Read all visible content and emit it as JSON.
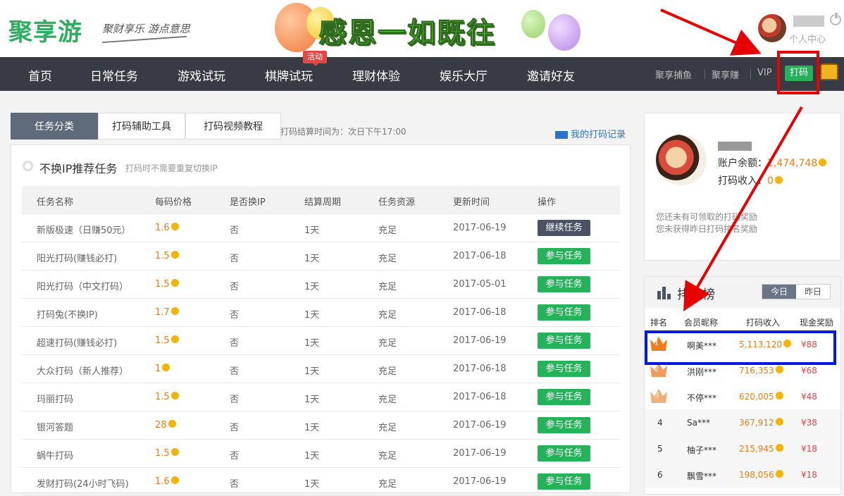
{
  "header": {
    "logo": "聚享游",
    "slogan": "聚财享乐 游点意思",
    "banner_text": "感恩一如既往",
    "personal_center": "个人中心"
  },
  "nav": {
    "items": [
      "首页",
      "日常任务",
      "游戏试玩",
      "棋牌试玩",
      "理财体验",
      "娱乐大厅",
      "邀请好友"
    ],
    "hot_badge": "活动",
    "right_items": [
      "聚享捕鱼",
      "聚享赚",
      "VIP"
    ],
    "dama_button": "打码"
  },
  "tabs": [
    "任务分类",
    "打码辅助工具",
    "打码视频教程"
  ],
  "settle_time": "打码结算时间为：次日下午17:00",
  "record_link": "我的打码记录",
  "section": {
    "title": "不换IP推荐任务",
    "subtitle": "打码时不需要重复切换IP"
  },
  "table": {
    "columns": [
      "任务名称",
      "每码价格",
      "是否换IP",
      "结算周期",
      "任务资源",
      "更新时间",
      "操作"
    ],
    "rows": [
      {
        "name": "新版极速（日赚50元）",
        "price": "1.6",
        "ip": "否",
        "cycle": "1天",
        "res": "充足",
        "date": "2017-06-19",
        "action": "继续任务"
      },
      {
        "name": "阳光打码(赚钱必打)",
        "price": "1.5",
        "ip": "否",
        "cycle": "1天",
        "res": "充足",
        "date": "2017-06-18",
        "action": "参与任务"
      },
      {
        "name": "阳光打码（中文打码）",
        "price": "1.5",
        "ip": "否",
        "cycle": "1天",
        "res": "充足",
        "date": "2017-05-01",
        "action": "参与任务"
      },
      {
        "name": "打码兔(不换IP)",
        "price": "1.7",
        "ip": "否",
        "cycle": "1天",
        "res": "充足",
        "date": "2017-06-18",
        "action": "参与任务"
      },
      {
        "name": "超速打码(赚钱必打)",
        "price": "1.5",
        "ip": "否",
        "cycle": "1天",
        "res": "充足",
        "date": "2017-06-19",
        "action": "参与任务"
      },
      {
        "name": "大众打码（新人推荐）",
        "price": "1",
        "ip": "否",
        "cycle": "1天",
        "res": "充足",
        "date": "2017-06-18",
        "action": "参与任务"
      },
      {
        "name": "玛丽打码",
        "price": "1.5",
        "ip": "否",
        "cycle": "1天",
        "res": "充足",
        "date": "2017-06-18",
        "action": "参与任务"
      },
      {
        "name": "银河答题",
        "price": "28",
        "ip": "否",
        "cycle": "1天",
        "res": "充足",
        "date": "2017-06-19",
        "action": "参与任务"
      },
      {
        "name": "蜗牛打码",
        "price": "1.5",
        "ip": "否",
        "cycle": "1天",
        "res": "充足",
        "date": "2017-06-19",
        "action": "参与任务"
      },
      {
        "name": "发财打码(24小时飞码)",
        "price": "1.6",
        "ip": "否",
        "cycle": "1天",
        "res": "充足",
        "date": "2017-06-19",
        "action": "参与任务"
      }
    ]
  },
  "account": {
    "balance_label": "账户余额：",
    "balance": "1,474,748",
    "income_label": "打码收入：",
    "income": "0",
    "notice1": "您还未有可领取的打码奖励",
    "notice2": "您未获得昨日打码排名奖励"
  },
  "ranking": {
    "title": "排名榜",
    "today": "今日",
    "yesterday": "昨日",
    "columns": [
      "排名",
      "会员昵称",
      "打码收入",
      "现金奖励"
    ],
    "rows": [
      {
        "rank": "1",
        "name": "啊美***",
        "income": "5,113,120",
        "cash": "¥88"
      },
      {
        "rank": "2",
        "name": "洪刚***",
        "income": "716,353",
        "cash": "¥68"
      },
      {
        "rank": "3",
        "name": "不停***",
        "income": "620,005",
        "cash": "¥48"
      },
      {
        "rank": "4",
        "name": "Sa***",
        "income": "367,912",
        "cash": "¥38"
      },
      {
        "rank": "5",
        "name": "柚子***",
        "income": "215,945",
        "cash": "¥18"
      },
      {
        "rank": "6",
        "name": "飘雪***",
        "income": "198,056",
        "cash": "¥18"
      }
    ]
  },
  "colors": {
    "brand_green": "#27b15b",
    "nav_dark": "#383b43",
    "price_orange": "#f07d1b",
    "cash_red": "#e24646",
    "annotation_red": "#e60000",
    "annotation_blue": "#0018e0"
  }
}
